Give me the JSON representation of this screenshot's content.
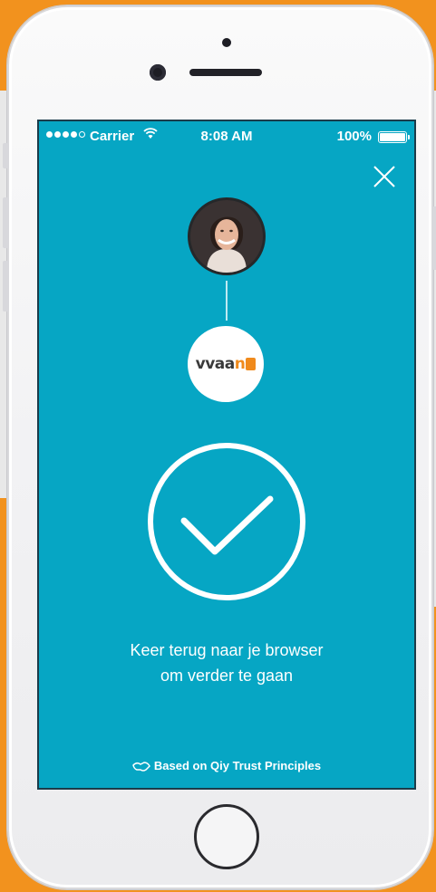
{
  "status_bar": {
    "carrier": "Carrier",
    "time": "8:08 AM",
    "battery": "100%",
    "signal_bars_filled": 4,
    "signal_bars_total": 5
  },
  "screen": {
    "background_color": "#06a6c4",
    "close_icon": "close-icon",
    "avatar_icon": "user-avatar",
    "logo": {
      "text_main": "vvaa",
      "text_accent": "n"
    },
    "success_icon": "check-circle-icon",
    "message_line1": "Keer terug naar je browser",
    "message_line2": "om verder te gaan",
    "footer": "Based on Qiy Trust Principles"
  },
  "colors": {
    "accent_orange": "#f08a1c",
    "screen_teal": "#06a6c4"
  }
}
